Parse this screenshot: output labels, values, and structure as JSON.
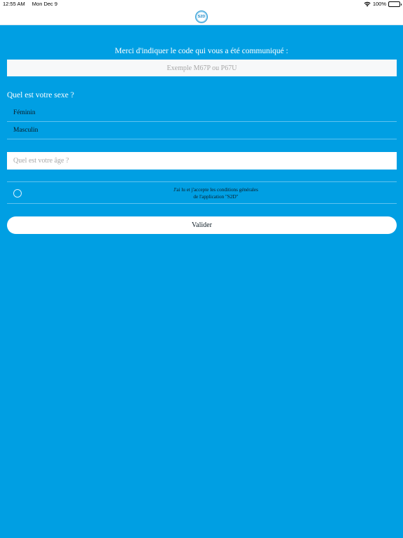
{
  "status_bar": {
    "time": "12:55 AM",
    "date": "Mon Dec 9",
    "battery": "100%"
  },
  "nav": {
    "logo_text": "S2D"
  },
  "code": {
    "prompt": "Merci d'indiquer le code qui vous a été communiqué :",
    "placeholder": "Exemple M67P ou P67U",
    "value": ""
  },
  "sex": {
    "title": "Quel est votre sexe ?",
    "options": [
      "Féminin",
      "Masculin"
    ]
  },
  "age": {
    "placeholder": "Quel est votre âge ?",
    "value": ""
  },
  "terms": {
    "line1": "J'ai lu et j'accepte les conditions générales",
    "line2": "de l'application \"S2D\"",
    "checked": false
  },
  "submit": {
    "label": "Valider"
  },
  "colors": {
    "background": "#009fe3",
    "accent": "#2a9bd6"
  },
  "icons": [
    "wifi-icon",
    "battery-icon",
    "app-logo",
    "radio-button"
  ]
}
